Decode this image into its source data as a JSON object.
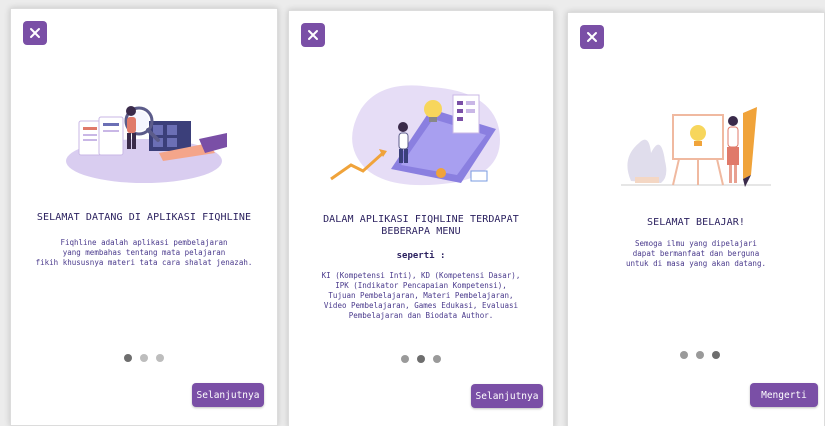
{
  "colors": {
    "accent": "#7a4fa6",
    "title_text": "#2c2260",
    "body_text": "#4a3a8c"
  },
  "slides": [
    {
      "title": "SELAMAT DATANG DI APLIKASI FIQHLINE",
      "body_lines": [
        "Fiqhline adalah aplikasi pembelajaran",
        "yang membahas tentang mata pelajaran",
        "fikih khususnya materi tata cara shalat jenazah."
      ],
      "button_label": "Selanjutnya",
      "illustration_icon": "search-document-illustration"
    },
    {
      "title_lines": [
        "DALAM APLIKASI FIQHLINE TERDAPAT",
        "BEBERAPA MENU"
      ],
      "subhead": "seperti :",
      "body_lines": [
        "KI (Kompetensi Inti), KD (Kompetensi Dasar),",
        "IPK (Indikator Pencapaian Kompetensi),",
        "Tujuan Pembelajaran, Materi Pembelajaran,",
        "Video Pembelajaran, Games Edukasi, Evaluasi",
        "Pembelajaran dan Biodata Author."
      ],
      "button_label": "Selanjutnya",
      "illustration_icon": "menu-dashboard-illustration"
    },
    {
      "title": "SELAMAT BELAJAR!",
      "body_lines": [
        "Semoga ilmu yang dipelajari",
        "dapat bermanfaat dan berguna",
        "untuk di masa yang akan datang."
      ],
      "button_label": "Mengerti",
      "illustration_icon": "lightbulb-easel-illustration"
    }
  ],
  "close_icon": "close-icon"
}
